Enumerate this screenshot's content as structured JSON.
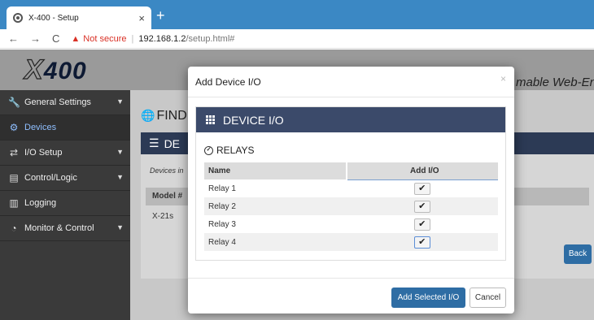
{
  "browser": {
    "tab_title": "X-400 - Setup",
    "tab_close": "×",
    "new_tab": "+",
    "nav_back": "←",
    "nav_forward": "→",
    "nav_reload": "C",
    "security_icon": "warning-triangle-icon",
    "security_text": "Not secure",
    "url_host": "192.168.1.2",
    "url_path": "/setup.html#"
  },
  "app": {
    "logo_x": "X",
    "logo_number": "400",
    "header_text": "mable Web-Ena",
    "sidebar": [
      {
        "label": "General Settings",
        "icon": "wrench-icon",
        "glyph": "🔧",
        "chevron": "▼"
      },
      {
        "label": "Devices",
        "icon": "gear-icon",
        "glyph": "⚙",
        "chevron": ""
      },
      {
        "label": "I/O Setup",
        "icon": "arrows-icon",
        "glyph": "⇄",
        "chevron": "▼"
      },
      {
        "label": "Control/Logic",
        "icon": "server-icon",
        "glyph": "▤",
        "chevron": "▼"
      },
      {
        "label": "Logging",
        "icon": "bar-chart-icon",
        "glyph": "▥",
        "chevron": ""
      },
      {
        "label": "Monitor & Control",
        "icon": "gauge-icon",
        "glyph": "◔",
        "chevron": "▼"
      }
    ],
    "main_title": "FIND",
    "panel_title": "DE",
    "panel_sub": "Devices in",
    "panel_col": "Model #",
    "panel_val": "X-21s",
    "back_button": "Back"
  },
  "modal": {
    "title": "Add Device I/O",
    "close": "×",
    "box_title": "DEVICE I/O",
    "section": "RELAYS",
    "columns": [
      "Name",
      "Add I/O"
    ],
    "rows": [
      {
        "name": "Relay 1",
        "checked": "✔"
      },
      {
        "name": "Relay 2",
        "checked": "✔"
      },
      {
        "name": "Relay 3",
        "checked": "✔"
      },
      {
        "name": "Relay 4",
        "checked": "✔"
      }
    ],
    "primary_button": "Add Selected I/O",
    "cancel_button": "Cancel"
  },
  "colors": {
    "tabbar": "#3b88c4",
    "sidebar": "#3a3a3a",
    "panel_header": "#2c3a55",
    "box_header": "#3b4a6a",
    "primary": "#2e6da4",
    "warning": "#d93025"
  }
}
